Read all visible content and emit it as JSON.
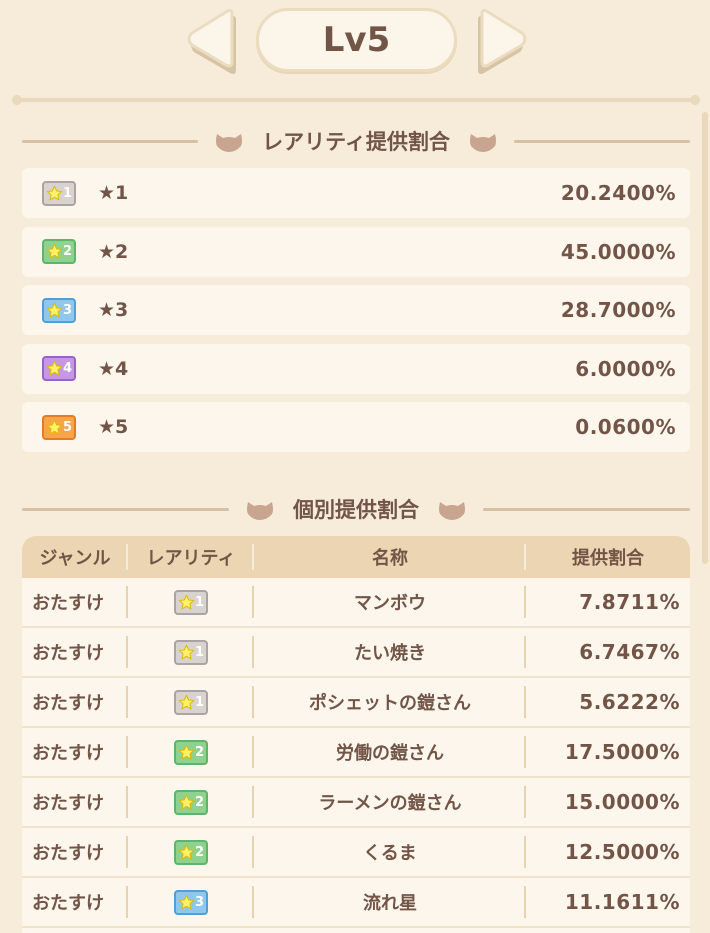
{
  "header": {
    "level": "Lv5"
  },
  "rarity_section": {
    "title": "レアリティ提供割合",
    "rows": [
      {
        "badge_num": "1",
        "label": "★1",
        "rate": "20.2400%",
        "badge_color": "#a9a3a3",
        "badge_bg": "#d9d3cf"
      },
      {
        "badge_num": "2",
        "label": "★2",
        "rate": "45.0000%",
        "badge_color": "#5fb36b",
        "badge_bg": "#8fd28d"
      },
      {
        "badge_num": "3",
        "label": "★3",
        "rate": "28.7000%",
        "badge_color": "#4f9fd8",
        "badge_bg": "#8ec8ef"
      },
      {
        "badge_num": "4",
        "label": "★4",
        "rate": "6.0000%",
        "badge_color": "#9a62c6",
        "badge_bg": "#c597e4"
      },
      {
        "badge_num": "5",
        "label": "★5",
        "rate": "0.0600%",
        "badge_color": "#e77b1e",
        "badge_bg": "#f7a44a"
      }
    ]
  },
  "individual_section": {
    "title": "個別提供割合",
    "columns": [
      "ジャンル",
      "レアリティ",
      "名称",
      "提供割合"
    ],
    "rows": [
      {
        "genre": "おたすけ",
        "rarity": "1",
        "name": "マンボウ",
        "rate": "7.8711%"
      },
      {
        "genre": "おたすけ",
        "rarity": "1",
        "name": "たい焼き",
        "rate": "6.7467%"
      },
      {
        "genre": "おたすけ",
        "rarity": "1",
        "name": "ポシェットの鎧さん",
        "rate": "5.6222%"
      },
      {
        "genre": "おたすけ",
        "rarity": "2",
        "name": "労働の鎧さん",
        "rate": "17.5000%"
      },
      {
        "genre": "おたすけ",
        "rarity": "2",
        "name": "ラーメンの鎧さん",
        "rate": "15.0000%"
      },
      {
        "genre": "おたすけ",
        "rarity": "2",
        "name": "くるま",
        "rate": "12.5000%"
      },
      {
        "genre": "おたすけ",
        "rarity": "3",
        "name": "流れ星",
        "rate": "11.1611%"
      }
    ]
  },
  "icons": {
    "arrow_left": "arrow-left-icon",
    "arrow_right": "arrow-right-icon",
    "cat": "cat-head-icon",
    "star": "star-icon"
  },
  "colors": {
    "background": "#f6ecd9",
    "text": "#735548",
    "table_header": "#ecd5b2"
  }
}
